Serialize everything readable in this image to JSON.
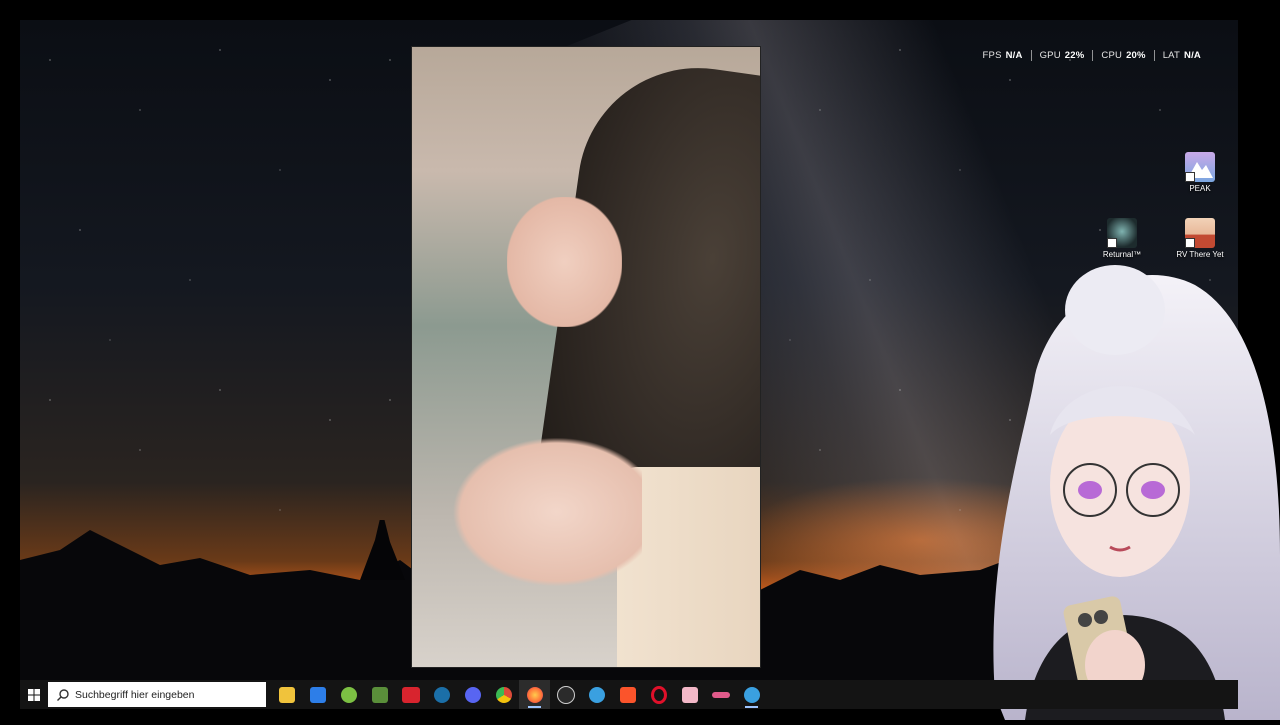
{
  "overlay": {
    "fps_label": "FPS",
    "fps_value": "N/A",
    "gpu_label": "GPU",
    "gpu_value": "22%",
    "cpu_label": "CPU",
    "cpu_value": "20%",
    "lat_label": "LAT",
    "lat_value": "N/A"
  },
  "desktop_icons": [
    {
      "label": "PEAK",
      "icon": "peak-game-icon"
    },
    {
      "label": "Returnal™",
      "icon": "returnal-game-icon"
    },
    {
      "label": "RV There Yet",
      "icon": "rv-there-yet-game-icon"
    }
  ],
  "taskbar": {
    "search_placeholder": "Suchbegriff hier eingeben",
    "apps": [
      {
        "name": "file-explorer",
        "icon": "folder-icon",
        "color": "#f0c33c"
      },
      {
        "name": "store",
        "icon": "store-icon",
        "color": "#2d7ee8"
      },
      {
        "name": "android-app",
        "icon": "android-icon",
        "color": "#7cc043"
      },
      {
        "name": "minecraft",
        "icon": "minecraft-icon",
        "color": "#5a8f3a"
      },
      {
        "name": "meister-app",
        "icon": "meister-icon",
        "color": "#d8242e"
      },
      {
        "name": "steam-1",
        "icon": "steam-icon",
        "color": "#1b6fa8"
      },
      {
        "name": "discord",
        "icon": "discord-icon",
        "color": "#5865f2"
      },
      {
        "name": "chrome",
        "icon": "chrome-icon",
        "color": "#dd4b39"
      },
      {
        "name": "firefox",
        "icon": "firefox-icon",
        "color": "#ff7139"
      },
      {
        "name": "speedometer-app",
        "icon": "speedometer-icon",
        "color": "#cfcfcf"
      },
      {
        "name": "sync-app",
        "icon": "sync-icon",
        "color": "#3aa0e0"
      },
      {
        "name": "brave",
        "icon": "brave-icon",
        "color": "#fb542b"
      },
      {
        "name": "opera",
        "icon": "opera-icon",
        "color": "#e0102a"
      },
      {
        "name": "photo-app",
        "icon": "photo-icon",
        "color": "#f4b8c8"
      },
      {
        "name": "pink-app",
        "icon": "pink-app-icon",
        "color": "#e05a8a"
      },
      {
        "name": "steam-2",
        "icon": "steam-icon",
        "color": "#3aa0e0"
      }
    ]
  },
  "colors": {
    "taskbar_bg": "#141414",
    "accent": "#9ec5ff"
  }
}
